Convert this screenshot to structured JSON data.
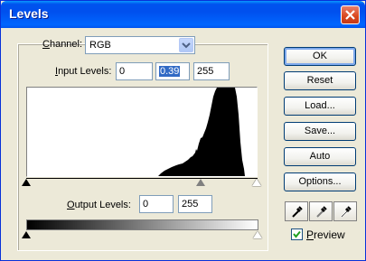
{
  "window": {
    "title": "Levels"
  },
  "channel": {
    "label_pre": "",
    "label_ul": "C",
    "label_post": "hannel:",
    "value": "RGB"
  },
  "input_levels": {
    "label_ul": "I",
    "label_post": "nput Levels:",
    "black": "0",
    "gamma": "0.39",
    "white": "255"
  },
  "output_levels": {
    "label_ul": "O",
    "label_post": "utput Levels:",
    "black": "0",
    "white": "255"
  },
  "buttons": {
    "ok": "OK",
    "reset": "Reset",
    "load": "Load...",
    "save": "Save...",
    "auto": "Auto",
    "options": "Options..."
  },
  "preview": {
    "label_ul": "P",
    "label_post": "review",
    "checked": true
  },
  "icons": [
    "close-icon",
    "dropdown-arrow-icon",
    "black-eyedropper-icon",
    "gray-eyedropper-icon",
    "white-eyedropper-icon",
    "checkmark-icon"
  ]
}
